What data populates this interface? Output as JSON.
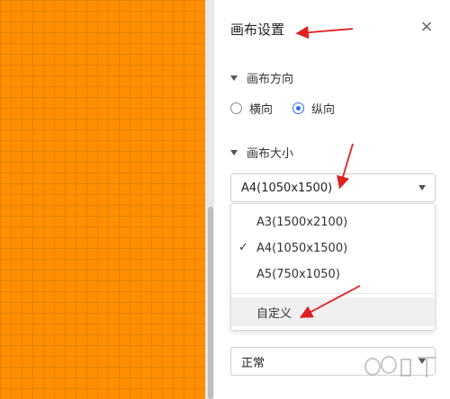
{
  "panel": {
    "title": "画布设置",
    "close_glyph": "×",
    "orientation": {
      "header": "画布方向",
      "options": [
        {
          "label": "横向",
          "checked": false
        },
        {
          "label": "纵向",
          "checked": true
        }
      ]
    },
    "size": {
      "header": "画布大小",
      "selected": "A4(1050x1500)",
      "options": [
        {
          "label": "A3(1500x2100)",
          "checked": false
        },
        {
          "label": "A4(1050x1500)",
          "checked": true
        },
        {
          "label": "A5(750x1050)",
          "checked": false
        },
        {
          "label": "自定义",
          "checked": false
        }
      ],
      "check_glyph": "✓"
    },
    "mode_select": {
      "selected": "正常"
    }
  },
  "colors": {
    "canvas": "#ff8f00",
    "accent": "#2b6cf0",
    "annotation": "#e02020"
  }
}
